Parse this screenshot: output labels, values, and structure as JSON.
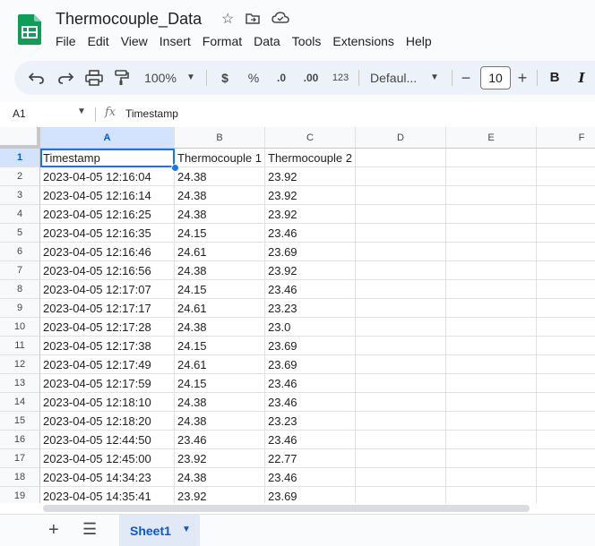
{
  "doc": {
    "title": "Thermocouple_Data"
  },
  "menu": [
    "File",
    "Edit",
    "View",
    "Insert",
    "Format",
    "Data",
    "Tools",
    "Extensions",
    "Help"
  ],
  "toolbar": {
    "zoom": "100%",
    "currency": "$",
    "percent": "%",
    "dec_decrease": ".0",
    "dec_increase": ".00",
    "number_format": "123",
    "font": "Defaul...",
    "font_size": "10",
    "minus": "−",
    "plus": "+",
    "bold": "B",
    "italic": "I"
  },
  "formula_bar": {
    "cell_ref": "A1",
    "fx": "fx",
    "content": "Timestamp"
  },
  "columns": [
    "A",
    "B",
    "C",
    "D",
    "E",
    "F"
  ],
  "rows": [
    {
      "n": "1",
      "a": "Timestamp",
      "b": "Thermocouple 1",
      "c": "Thermocouple 2"
    },
    {
      "n": "2",
      "a": "2023-04-05 12:16:04",
      "b": "24.38",
      "c": "23.92"
    },
    {
      "n": "3",
      "a": "2023-04-05 12:16:14",
      "b": "24.38",
      "c": "23.92"
    },
    {
      "n": "4",
      "a": "2023-04-05 12:16:25",
      "b": "24.38",
      "c": "23.92"
    },
    {
      "n": "5",
      "a": "2023-04-05 12:16:35",
      "b": "24.15",
      "c": "23.46"
    },
    {
      "n": "6",
      "a": "2023-04-05 12:16:46",
      "b": "24.61",
      "c": "23.69"
    },
    {
      "n": "7",
      "a": "2023-04-05 12:16:56",
      "b": "24.38",
      "c": "23.92"
    },
    {
      "n": "8",
      "a": "2023-04-05 12:17:07",
      "b": "24.15",
      "c": "23.46"
    },
    {
      "n": "9",
      "a": "2023-04-05 12:17:17",
      "b": "24.61",
      "c": "23.23"
    },
    {
      "n": "10",
      "a": "2023-04-05 12:17:28",
      "b": "24.38",
      "c": "23.0"
    },
    {
      "n": "11",
      "a": "2023-04-05 12:17:38",
      "b": "24.15",
      "c": "23.69"
    },
    {
      "n": "12",
      "a": "2023-04-05 12:17:49",
      "b": "24.61",
      "c": "23.69"
    },
    {
      "n": "13",
      "a": "2023-04-05 12:17:59",
      "b": "24.15",
      "c": "23.46"
    },
    {
      "n": "14",
      "a": "2023-04-05 12:18:10",
      "b": "24.38",
      "c": "23.46"
    },
    {
      "n": "15",
      "a": "2023-04-05 12:18:20",
      "b": "24.38",
      "c": "23.23"
    },
    {
      "n": "16",
      "a": "2023-04-05 12:44:50",
      "b": "23.46",
      "c": "23.46"
    },
    {
      "n": "17",
      "a": "2023-04-05 12:45:00",
      "b": "23.92",
      "c": "22.77"
    },
    {
      "n": "18",
      "a": "2023-04-05 14:34:23",
      "b": "24.38",
      "c": "23.46"
    },
    {
      "n": "19",
      "a": "2023-04-05 14:35:41",
      "b": "23.92",
      "c": "23.69"
    }
  ],
  "sheets": [
    {
      "name": "Sheet1"
    }
  ],
  "colors": {
    "accent": "#0b57d0",
    "selection": "#1a73e8",
    "logo": "#0f9d58"
  }
}
